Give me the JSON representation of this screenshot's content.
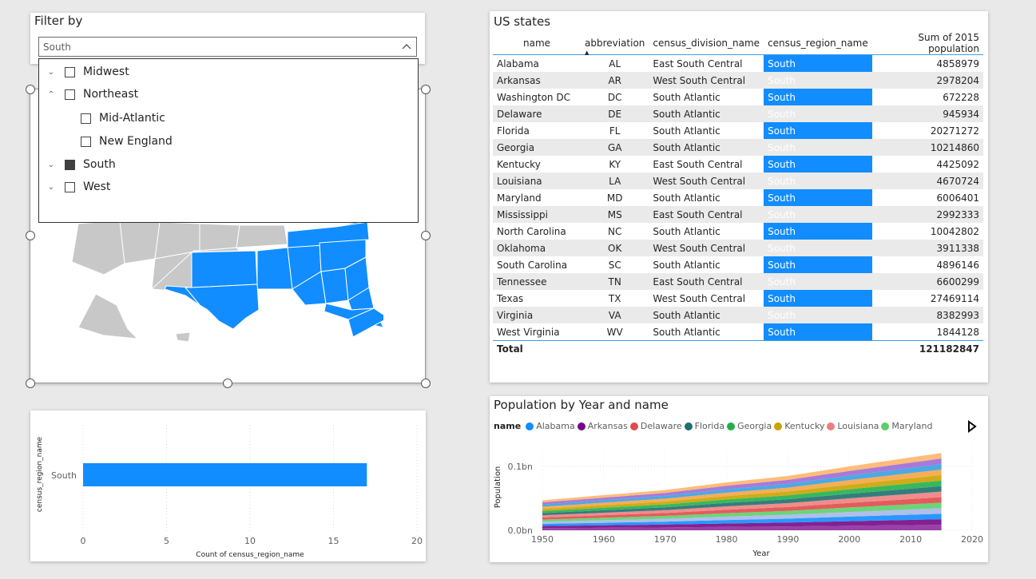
{
  "filter": {
    "title": "Filter by",
    "selected_value": "South",
    "items": [
      {
        "label": "Midwest",
        "checked": false
      },
      {
        "label": "Northeast",
        "checked": false
      },
      {
        "label": "Mid-Atlantic",
        "checked": false
      },
      {
        "label": "New England",
        "checked": false
      },
      {
        "label": "South",
        "checked": true
      },
      {
        "label": "West",
        "checked": false
      }
    ]
  },
  "table": {
    "title": "US states",
    "columns": [
      "name",
      "abbreviation",
      "census_division_name",
      "census_region_name",
      "Sum of 2015 population"
    ],
    "rows": [
      [
        "Alabama",
        "AL",
        "East South Central",
        "South",
        "4858979"
      ],
      [
        "Arkansas",
        "AR",
        "West South Central",
        "South",
        "2978204"
      ],
      [
        "Washington DC",
        "DC",
        "South Atlantic",
        "South",
        "672228"
      ],
      [
        "Delaware",
        "DE",
        "South Atlantic",
        "South",
        "945934"
      ],
      [
        "Florida",
        "FL",
        "South Atlantic",
        "South",
        "20271272"
      ],
      [
        "Georgia",
        "GA",
        "South Atlantic",
        "South",
        "10214860"
      ],
      [
        "Kentucky",
        "KY",
        "East South Central",
        "South",
        "4425092"
      ],
      [
        "Louisiana",
        "LA",
        "West South Central",
        "South",
        "4670724"
      ],
      [
        "Maryland",
        "MD",
        "South Atlantic",
        "South",
        "6006401"
      ],
      [
        "Mississippi",
        "MS",
        "East South Central",
        "South",
        "2992333"
      ],
      [
        "North Carolina",
        "NC",
        "South Atlantic",
        "South",
        "10042802"
      ],
      [
        "Oklahoma",
        "OK",
        "West South Central",
        "South",
        "3911338"
      ],
      [
        "South Carolina",
        "SC",
        "South Atlantic",
        "South",
        "4896146"
      ],
      [
        "Tennessee",
        "TN",
        "East South Central",
        "South",
        "6600299"
      ],
      [
        "Texas",
        "TX",
        "West South Central",
        "South",
        "27469114"
      ],
      [
        "Virginia",
        "VA",
        "South Atlantic",
        "South",
        "8382993"
      ],
      [
        "West Virginia",
        "WV",
        "South Atlantic",
        "South",
        "1844128"
      ]
    ],
    "total_label": "Total",
    "total_value": "121182847"
  },
  "colors": {
    "accent": "#118dff",
    "map_grey": "#c8c8c8"
  },
  "chart_data": [
    {
      "type": "bar",
      "orientation": "horizontal",
      "categories": [
        "South"
      ],
      "values": [
        17
      ],
      "xlabel": "Count of census_region_name",
      "ylabel": "census_region_name",
      "xlim": [
        0,
        20
      ],
      "ticks": [
        "0",
        "5",
        "10",
        "15",
        "20"
      ],
      "color": "#118dff"
    },
    {
      "type": "area",
      "title": "Population by Year and name",
      "legend_title": "name",
      "legend": [
        {
          "name": "Alabama",
          "color": "#118dff"
        },
        {
          "name": "Arkansas",
          "color": "#750985"
        },
        {
          "name": "Delaware",
          "color": "#e04a4a"
        },
        {
          "name": "Florida",
          "color": "#1f6f6f"
        },
        {
          "name": "Georgia",
          "color": "#22b04c"
        },
        {
          "name": "Kentucky",
          "color": "#c9a400"
        },
        {
          "name": "Louisiana",
          "color": "#ef7f7f"
        },
        {
          "name": "Maryland",
          "color": "#5ccf6a"
        }
      ],
      "xlabel": "Year",
      "ylabel": "Population",
      "x_ticks": [
        "1950",
        "1960",
        "1970",
        "1980",
        "1990",
        "2000",
        "2010",
        "2020"
      ],
      "y_ticks": [
        "0.0bn",
        "0.1bn"
      ],
      "total_series": [
        {
          "year": 1950,
          "value": 0.047
        },
        {
          "year": 1960,
          "value": 0.055
        },
        {
          "year": 1970,
          "value": 0.063
        },
        {
          "year": 1980,
          "value": 0.075
        },
        {
          "year": 1990,
          "value": 0.085
        },
        {
          "year": 2000,
          "value": 0.1
        },
        {
          "year": 2010,
          "value": 0.114
        },
        {
          "year": 2015,
          "value": 0.121
        }
      ],
      "stack_colors": [
        "#8e2ba0",
        "#750985",
        "#118dff",
        "#a8b7e8",
        "#5ccf6a",
        "#e04a4a",
        "#ef7f7f",
        "#1f6f6f",
        "#22b04c",
        "#c9a400",
        "#f5a542",
        "#3aa0e0",
        "#9c6bd6",
        "#ffb56b"
      ]
    }
  ]
}
